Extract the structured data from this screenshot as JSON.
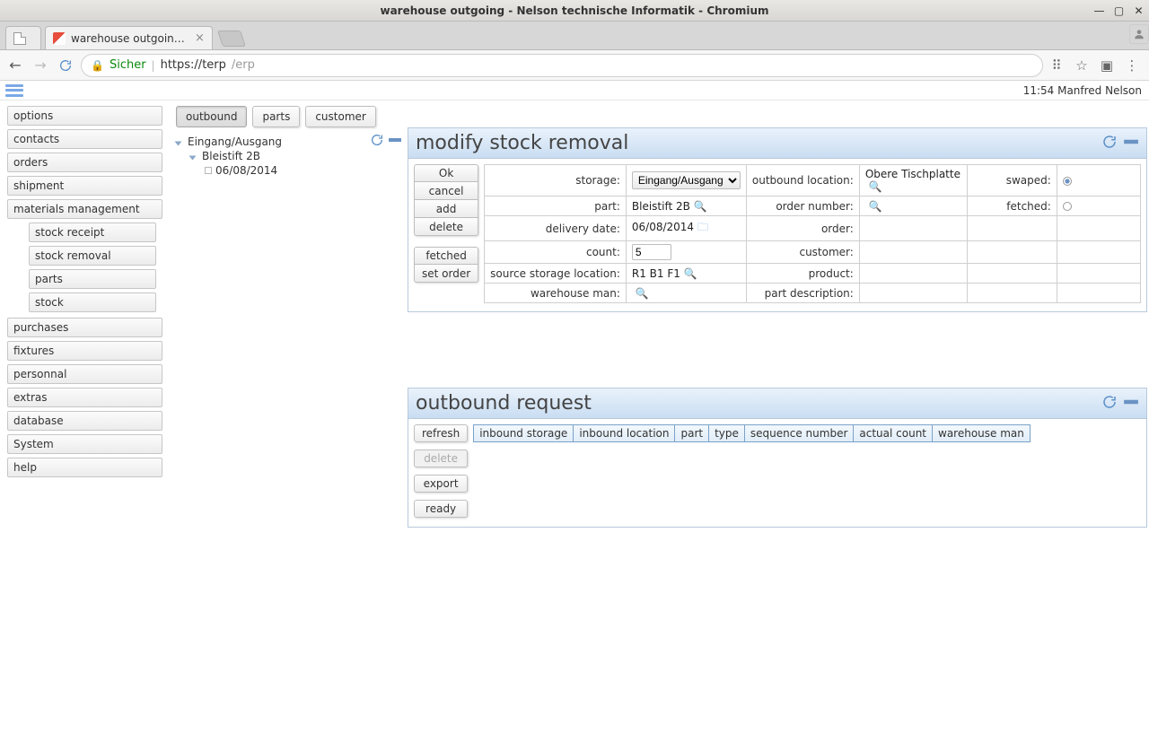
{
  "os": {
    "title": "warehouse outgoing - Nelson technische Informatik - Chromium"
  },
  "browser": {
    "tabs": [
      {
        "label": ""
      },
      {
        "label": "warehouse outgoing - Ne"
      }
    ],
    "secure_label": "Sicher",
    "url_host": "https://terp",
    "url_path": "/erp"
  },
  "app": {
    "time_user": "11:54 Manfred Nelson"
  },
  "sidebar": {
    "items": [
      "options",
      "contacts",
      "orders",
      "shipment",
      "materials management"
    ],
    "sub_materials": [
      "stock receipt",
      "stock removal",
      "parts",
      "stock"
    ],
    "items2": [
      "purchases",
      "fixtures",
      "personnal",
      "extras",
      "database",
      "System",
      "help"
    ]
  },
  "erptabs": {
    "t0": "outbound",
    "t1": "parts",
    "t2": "customer"
  },
  "tree": {
    "n0": "Eingang/Ausgang",
    "n1": "Bleistift 2B",
    "n2": "06/08/2014"
  },
  "modify": {
    "title": "modify stock removal",
    "buttons": {
      "ok": "Ok",
      "cancel": "cancel",
      "add": "add",
      "delete": "delete",
      "fetched": "fetched",
      "setorder": "set order"
    },
    "labels": {
      "storage": "storage:",
      "part": "part:",
      "delivery_date": "delivery date:",
      "count": "count:",
      "source_storage": "source storage location:",
      "warehouse_man": "warehouse man:",
      "outbound_loc": "outbound location:",
      "order_number": "order number:",
      "order": "order:",
      "customer": "customer:",
      "product": "product:",
      "part_desc": "part description:",
      "swaped": "swaped:",
      "fetched": "fetched:"
    },
    "values": {
      "storage": "Eingang/Ausgang",
      "part": "Bleistift 2B",
      "delivery_date": "06/08/2014",
      "count": "5",
      "source_storage": "R1 B1 F1",
      "outbound_loc": "Obere Tischplatte"
    }
  },
  "outbound": {
    "title": "outbound request",
    "buttons": {
      "refresh": "refresh",
      "delete": "delete",
      "export": "export",
      "ready": "ready"
    },
    "cols": [
      "inbound storage",
      "inbound location",
      "part",
      "type",
      "sequence number",
      "actual count",
      "warehouse man"
    ]
  }
}
